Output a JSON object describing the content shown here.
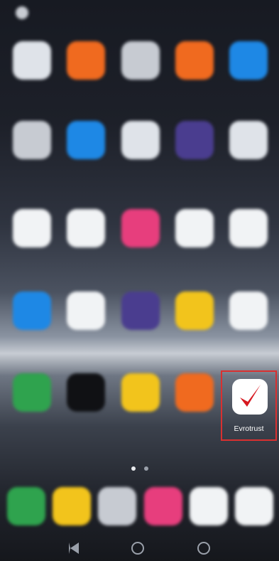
{
  "status_bar": {
    "text": "",
    "left_icon": "settings-icon"
  },
  "apps": [
    {
      "label": "",
      "icon": "folder-grid-icon",
      "color": "#dfe3e9"
    },
    {
      "label": "",
      "icon": "orange-app-icon",
      "color": "#f06a1f"
    },
    {
      "label": "",
      "icon": "folder-grid-icon",
      "color": "#c7cbd2"
    },
    {
      "label": "",
      "icon": "gallery-icon",
      "color": "#f06a1f"
    },
    {
      "label": "",
      "icon": "blue-app-icon",
      "color": "#1e88e5"
    },
    {
      "label": "",
      "icon": "circle-app-icon",
      "color": "#c7cbd2"
    },
    {
      "label": "",
      "icon": "blue-app-icon",
      "color": "#1e88e5"
    },
    {
      "label": "",
      "icon": "round-app-icon",
      "color": "#dfe3e9"
    },
    {
      "label": "",
      "icon": "purple-app-icon",
      "color": "#4a3d8f"
    },
    {
      "label": "",
      "icon": "grid-app-icon",
      "color": "#dfe3e9"
    },
    {
      "label": "",
      "icon": "gmail-icon",
      "color": "#f1f3f5"
    },
    {
      "label": "",
      "icon": "google-icon",
      "color": "#f1f3f5"
    },
    {
      "label": "",
      "icon": "game-icon",
      "color": "#e73e7d"
    },
    {
      "label": "",
      "icon": "app-icon",
      "color": "#f1f3f5"
    },
    {
      "label": "",
      "icon": "app-icon",
      "color": "#f1f3f5"
    },
    {
      "label": "",
      "icon": "blue-app-icon",
      "color": "#1e88e5"
    },
    {
      "label": "",
      "icon": "navigation-icon",
      "color": "#f1f3f5"
    },
    {
      "label": "",
      "icon": "settings-icon",
      "color": "#4a3d8f"
    },
    {
      "label": "",
      "icon": "folder-icon",
      "color": "#f2c41c"
    },
    {
      "label": "",
      "icon": "pen-icon",
      "color": "#f1f3f5"
    },
    {
      "label": "",
      "icon": "green-app-icon",
      "color": "#2fa34e"
    },
    {
      "label": "",
      "icon": "terminal-icon",
      "color": "#101114"
    },
    {
      "label": "",
      "icon": "folder-icon",
      "color": "#f2c41c"
    },
    {
      "label": "",
      "icon": "orange-app-icon",
      "color": "#f06a1f"
    }
  ],
  "highlighted_app": {
    "label": "Evrotrust",
    "icon": "evrotrust-check-icon",
    "accent": "#d71920",
    "highlight_border": "#d93030"
  },
  "page_indicator": {
    "count": 2,
    "active": 0
  },
  "dock": [
    {
      "icon": "phone-icon",
      "color": "#2fa34e"
    },
    {
      "icon": "messages-icon",
      "color": "#f2c41c"
    },
    {
      "icon": "camera-icon",
      "color": "#c7cbd2"
    },
    {
      "icon": "photos-icon",
      "color": "#e73e7d"
    },
    {
      "icon": "play-store-icon",
      "color": "#f1f3f5"
    },
    {
      "icon": "chrome-icon",
      "color": "#f1f3f5"
    }
  ],
  "nav_bar": {
    "buttons": [
      "back-icon",
      "home-icon",
      "recents-icon"
    ]
  }
}
